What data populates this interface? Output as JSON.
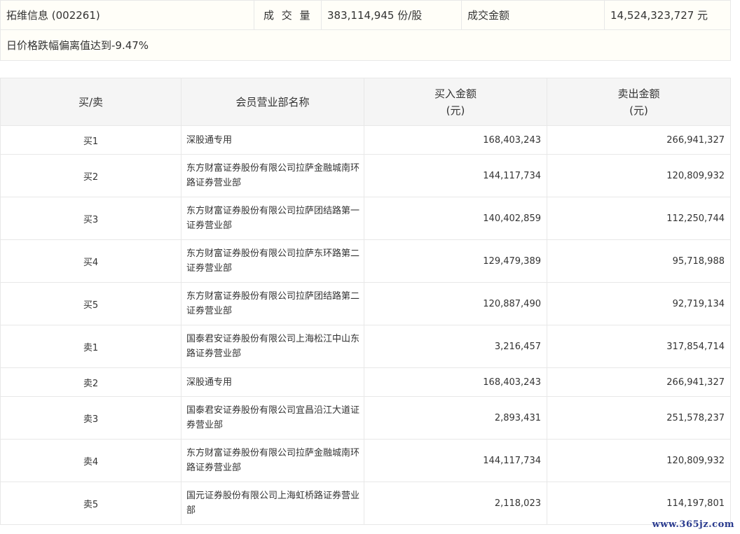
{
  "summary": {
    "stock": "拓维信息 (002261)",
    "volume_label": "成 交 量",
    "volume_value": "383,114,945 份/股",
    "amount_label": "成交金额",
    "amount_value": "14,524,323,727 元",
    "reason": "日价格跌幅偏离值达到-9.47%"
  },
  "table": {
    "headers": {
      "side": "买/卖",
      "name": "会员营业部名称",
      "buy_line1": "买入金额",
      "buy_line2": "(元)",
      "sell_line1": "卖出金额",
      "sell_line2": "(元)"
    },
    "rows": [
      {
        "side": "买1",
        "name": "深股通专用",
        "buy": "168,403,243",
        "sell": "266,941,327"
      },
      {
        "side": "买2",
        "name": "东方财富证券股份有限公司拉萨金融城南环路证券营业部",
        "buy": "144,117,734",
        "sell": "120,809,932"
      },
      {
        "side": "买3",
        "name": "东方财富证券股份有限公司拉萨团结路第一证券营业部",
        "buy": "140,402,859",
        "sell": "112,250,744"
      },
      {
        "side": "买4",
        "name": "东方财富证券股份有限公司拉萨东环路第二证券营业部",
        "buy": "129,479,389",
        "sell": "95,718,988"
      },
      {
        "side": "买5",
        "name": "东方财富证券股份有限公司拉萨团结路第二证券营业部",
        "buy": "120,887,490",
        "sell": "92,719,134"
      },
      {
        "side": "卖1",
        "name": "国泰君安证券股份有限公司上海松江中山东路证券营业部",
        "buy": "3,216,457",
        "sell": "317,854,714"
      },
      {
        "side": "卖2",
        "name": "深股通专用",
        "buy": "168,403,243",
        "sell": "266,941,327"
      },
      {
        "side": "卖3",
        "name": "国泰君安证券股份有限公司宜昌沿江大道证券营业部",
        "buy": "2,893,431",
        "sell": "251,578,237"
      },
      {
        "side": "卖4",
        "name": "东方财富证券股份有限公司拉萨金融城南环路证券营业部",
        "buy": "144,117,734",
        "sell": "120,809,932"
      },
      {
        "side": "卖5",
        "name": "国元证券股份有限公司上海虹桥路证券营业部",
        "buy": "2,118,023",
        "sell": "114,197,801"
      }
    ]
  },
  "watermark": "www.365jz.com"
}
